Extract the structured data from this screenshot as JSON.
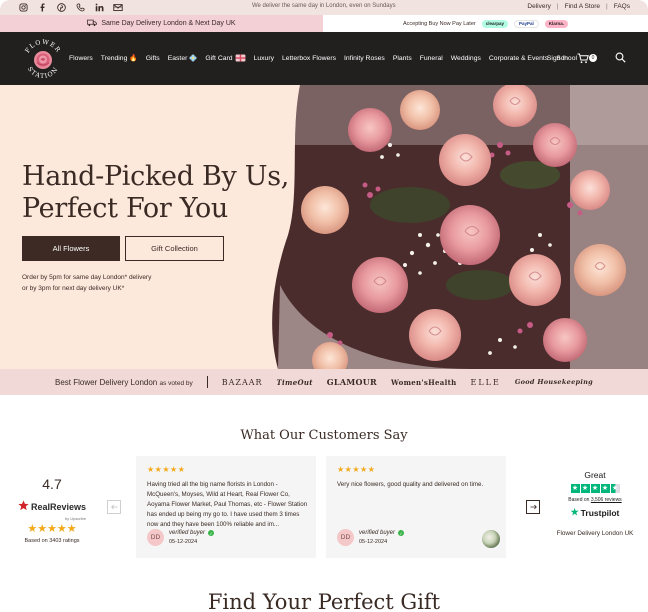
{
  "topbar": {
    "social_icons": [
      "instagram-icon",
      "facebook-icon",
      "pinterest-icon",
      "phone-icon",
      "linkedin-icon",
      "email-icon"
    ],
    "center_text": "We deliver the same day in London, even on Sundays",
    "links": [
      "Delivery",
      "Find A Store",
      "FAQs"
    ]
  },
  "promo": {
    "left_text": "Same Day Delivery London & Next Day UK",
    "right_text": "Accepting Buy Now Pay Later",
    "payment_badges": [
      "clearpay",
      "PayPal",
      "Klarna."
    ]
  },
  "nav": {
    "logo_text": "FLOWER STATION",
    "items": [
      "Flowers",
      "Trending 🔥",
      "Gifts",
      "Easter",
      "Gift Card",
      "Luxury",
      "Letterbox Flowers",
      "Infinity Roses",
      "Plants",
      "Funeral",
      "Weddings",
      "Corporate & Events",
      "School"
    ],
    "signin": "Sign In",
    "cart_count": "0"
  },
  "hero": {
    "title_line1": "Hand-Picked By Us,",
    "title_line2": "Perfect For You",
    "primary_button": "All Flowers",
    "secondary_button": "Gift Collection",
    "note_line1": "Order by 5pm for same day London* delivery",
    "note_line2": "or by 3pm for next day delivery UK*"
  },
  "voted": {
    "label": "Best Flower Delivery London",
    "label_suffix": "as voted by",
    "publications": [
      "BAZAAR",
      "TimeOut",
      "GLAMOUR",
      "Women'sHealth",
      "ELLE",
      "Good Housekeeping"
    ]
  },
  "reviews": {
    "title": "What Our Customers Say",
    "summary": {
      "score": "4.7",
      "brand": "RealReviews",
      "brand_sub": "by Upscribe",
      "stars": "★★★★★",
      "based_on": "Based on 3403 ratings"
    },
    "items": [
      {
        "stars": "★★★★★",
        "text": "Having tried all the big name florists in London - McQueen's, Moyses, Wild at Heart, Real Flower Co, Aoyama Flower Market, Paul Thomas, etc - Flower Station has ended up being my go to. I have used them 3 times now and they have been 100% reliable and im...",
        "avatar": "DD",
        "verified": "verified buyer",
        "date": "05-12-2024"
      },
      {
        "stars": "★★★★★",
        "text": "Very nice flowers, good quality and delivered on time.",
        "avatar": "DD",
        "verified": "verified buyer",
        "date": "05-12-2024"
      }
    ],
    "trustpilot": {
      "rating_word": "Great",
      "based_prefix": "Based on",
      "review_count": "3,506 reviews",
      "brand": "Trustpilot",
      "caption": "Flower Delivery London UK"
    }
  },
  "find": {
    "title": "Find Your Perfect Gift"
  },
  "colors": {
    "nav_bg": "#221f1f",
    "hero_bg": "#fde9dc",
    "promo_pink": "#f3cfd6",
    "button_brown": "#3d2a24",
    "star_gold": "#f3a91a",
    "trustpilot_green": "#00b67a"
  }
}
